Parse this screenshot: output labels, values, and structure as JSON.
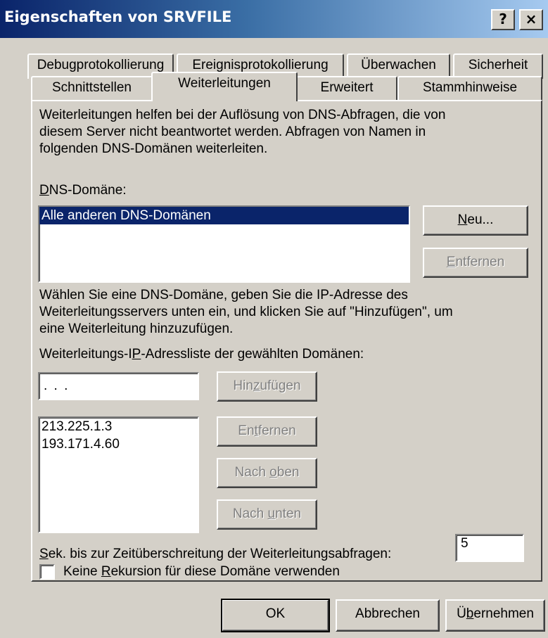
{
  "window": {
    "title": "Eigenschaften von SRVFILE",
    "help_button": "?",
    "close_button": "×"
  },
  "tabs_row1": [
    "Debugprotokollierung",
    "Ereignisprotokollierung",
    "Überwachen",
    "Sicherheit"
  ],
  "tabs_row2": [
    "Schnittstellen",
    "Weiterleitungen",
    "Erweitert",
    "Stammhinweise"
  ],
  "active_tab": "Weiterleitungen",
  "panel": {
    "intro_line1": "Weiterleitungen helfen bei der Auflösung von DNS-Abfragen, die von",
    "intro_line2": "diesem Server nicht beantwortet werden. Abfragen von Namen in",
    "intro_line3": "folgenden DNS-Domänen weiterleiten.",
    "dns_domain_label_u": "D",
    "dns_domain_label_rest": "NS-Domäne:",
    "domains": [
      "Alle anderen DNS-Domänen"
    ],
    "new_button_u": "N",
    "new_button_rest": "eu...",
    "remove_domain_button_u": "E",
    "remove_domain_button_rest": "ntfernen",
    "help_line1": "Wählen Sie eine DNS-Domäne, geben Sie die IP-Adresse des",
    "help_line2": "Weiterleitungsservers unten ein, und klicken Sie auf \"Hinzufügen\", um",
    "help_line3": "eine Weiterleitung hinzuzufügen.",
    "ip_list_label_pre": "Weiterleitungs-I",
    "ip_list_label_u": "P",
    "ip_list_label_post": "-Adressliste der gewählten Domänen:",
    "ip_input_value": ".        .        .",
    "add_button_pre": "Hin",
    "add_button_u": "z",
    "add_button_post": "ufügen",
    "ip_addresses": [
      "213.225.1.3",
      "193.171.4.60"
    ],
    "remove_ip_button_pre": "En",
    "remove_ip_button_u": "t",
    "remove_ip_button_post": "fernen",
    "move_up_pre": "Nach ",
    "move_up_u": "o",
    "move_up_post": "ben",
    "move_down_pre": "Nach ",
    "move_down_u": "u",
    "move_down_post": "nten",
    "timeout_label_u": "S",
    "timeout_label_rest": "ek. bis zur Zeitüberschreitung der Weiterleitungsabfragen:",
    "timeout_value": "5",
    "recursion_pre": "Keine ",
    "recursion_u": "R",
    "recursion_post": "ekursion für diese Domäne verwenden",
    "recursion_checked": false
  },
  "footer": {
    "ok_label": "OK",
    "cancel_label": "Abbrechen",
    "apply_pre": "Ü",
    "apply_u": "b",
    "apply_post": "ernehmen"
  }
}
